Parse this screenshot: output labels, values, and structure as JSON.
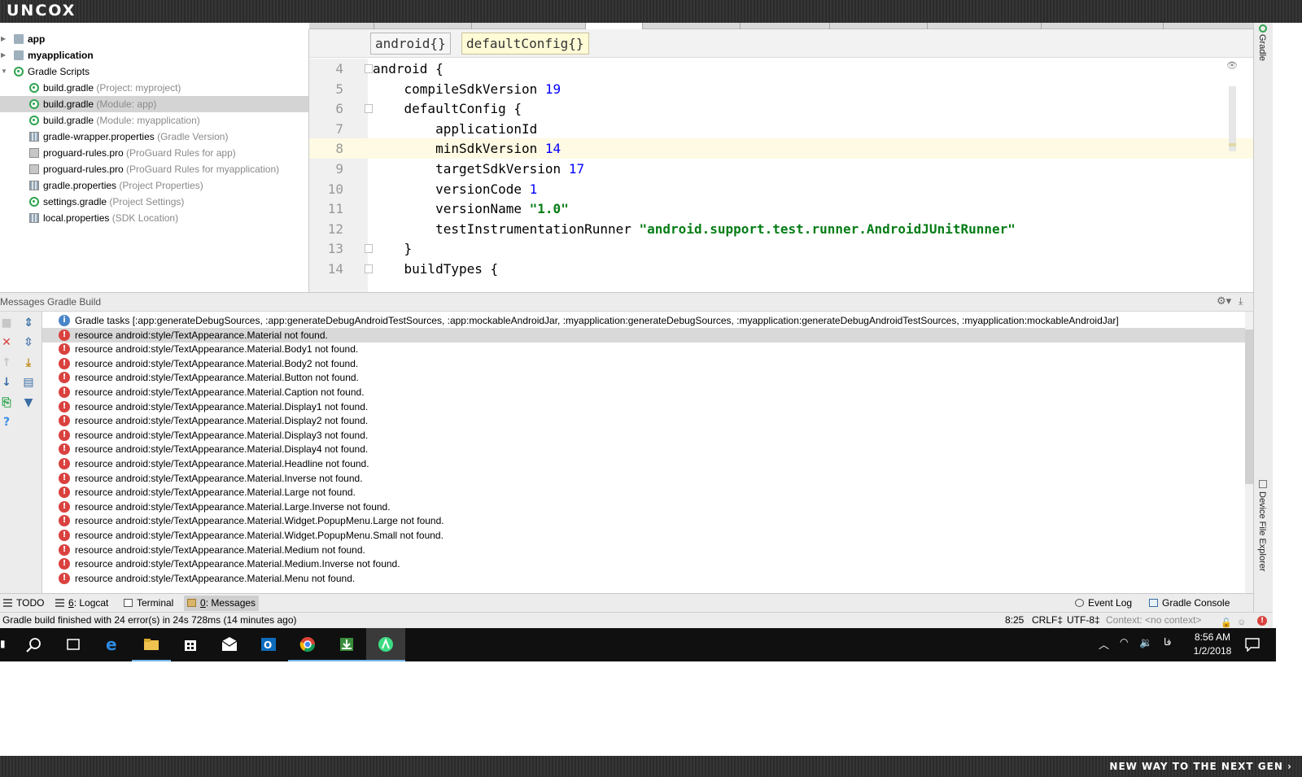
{
  "brand": "UNCOX",
  "project_tree": [
    {
      "label": "app",
      "hint": "",
      "icon": "folder-icon",
      "level": 0,
      "bold": true
    },
    {
      "label": "myapplication",
      "hint": "",
      "icon": "folder-icon",
      "level": 0,
      "bold": true
    },
    {
      "label": "Gradle Scripts",
      "hint": "",
      "icon": "gradle-icon",
      "level": 0,
      "bold": false
    },
    {
      "label": "build.gradle",
      "hint": "(Project: myproject)",
      "icon": "gradle-icon",
      "level": 1
    },
    {
      "label": "build.gradle",
      "hint": "(Module: app)",
      "icon": "gradle-icon",
      "level": 1,
      "selected": true
    },
    {
      "label": "build.gradle",
      "hint": "(Module: myapplication)",
      "icon": "gradle-icon",
      "level": 1
    },
    {
      "label": "gradle-wrapper.properties",
      "hint": "(Gradle Version)",
      "icon": "properties-icon",
      "level": 1
    },
    {
      "label": "proguard-rules.pro",
      "hint": "(ProGuard Rules for app)",
      "icon": "file-icon",
      "level": 1
    },
    {
      "label": "proguard-rules.pro",
      "hint": "(ProGuard Rules for myapplication)",
      "icon": "file-icon",
      "level": 1
    },
    {
      "label": "gradle.properties",
      "hint": "(Project Properties)",
      "icon": "properties-icon",
      "level": 1
    },
    {
      "label": "settings.gradle",
      "hint": "(Project Settings)",
      "icon": "gradle-icon",
      "level": 1
    },
    {
      "label": "local.properties",
      "hint": "(SDK Location)",
      "icon": "properties-icon",
      "level": 1
    }
  ],
  "editor": {
    "breadcrumbs": [
      "android{}",
      "defaultConfig{}"
    ],
    "current_line": "8",
    "lines": [
      {
        "n": "4",
        "fold": true,
        "parts": [
          {
            "t": "android {",
            "c": "plain"
          }
        ]
      },
      {
        "n": "5",
        "fold": false,
        "parts": [
          {
            "t": "    compileSdkVersion ",
            "c": "plain"
          },
          {
            "t": "19",
            "c": "num"
          }
        ]
      },
      {
        "n": "6",
        "fold": true,
        "parts": [
          {
            "t": "    defaultConfig {",
            "c": "plain"
          }
        ]
      },
      {
        "n": "7",
        "fold": false,
        "parts": [
          {
            "t": "        applicationId",
            "c": "plain"
          }
        ]
      },
      {
        "n": "8",
        "fold": false,
        "parts": [
          {
            "t": "        minSdkVersion ",
            "c": "plain"
          },
          {
            "t": "14",
            "c": "num"
          }
        ]
      },
      {
        "n": "9",
        "fold": false,
        "parts": [
          {
            "t": "        targetSdkVersion ",
            "c": "plain"
          },
          {
            "t": "17",
            "c": "num"
          }
        ]
      },
      {
        "n": "10",
        "fold": false,
        "parts": [
          {
            "t": "        versionCode ",
            "c": "plain"
          },
          {
            "t": "1",
            "c": "num"
          }
        ]
      },
      {
        "n": "11",
        "fold": false,
        "parts": [
          {
            "t": "        versionName ",
            "c": "plain"
          },
          {
            "t": "\"1.0\"",
            "c": "str"
          }
        ]
      },
      {
        "n": "12",
        "fold": false,
        "parts": [
          {
            "t": "        testInstrumentationRunner ",
            "c": "plain"
          },
          {
            "t": "\"android.support.test.runner.AndroidJUnitRunner\"",
            "c": "str"
          }
        ]
      },
      {
        "n": "13",
        "fold": true,
        "parts": [
          {
            "t": "    }",
            "c": "plain"
          }
        ]
      },
      {
        "n": "14",
        "fold": true,
        "parts": [
          {
            "t": "    buildTypes {",
            "c": "plain"
          }
        ]
      }
    ]
  },
  "right_stripe": {
    "gradle_tab": "Gradle",
    "device_tab": "Device File Explorer"
  },
  "messages": {
    "title": "Messages Gradle Build",
    "items": [
      {
        "type": "info",
        "text": "Gradle tasks [:app:generateDebugSources, :app:generateDebugAndroidTestSources, :app:mockableAndroidJar, :myapplication:generateDebugSources, :myapplication:generateDebugAndroidTestSources, :myapplication:mockableAndroidJar]"
      },
      {
        "type": "error",
        "text": "resource android:style/TextAppearance.Material not found.",
        "selected": true
      },
      {
        "type": "error",
        "text": "resource android:style/TextAppearance.Material.Body1 not found."
      },
      {
        "type": "error",
        "text": "resource android:style/TextAppearance.Material.Body2 not found."
      },
      {
        "type": "error",
        "text": "resource android:style/TextAppearance.Material.Button not found."
      },
      {
        "type": "error",
        "text": "resource android:style/TextAppearance.Material.Caption not found."
      },
      {
        "type": "error",
        "text": "resource android:style/TextAppearance.Material.Display1 not found."
      },
      {
        "type": "error",
        "text": "resource android:style/TextAppearance.Material.Display2 not found."
      },
      {
        "type": "error",
        "text": "resource android:style/TextAppearance.Material.Display3 not found."
      },
      {
        "type": "error",
        "text": "resource android:style/TextAppearance.Material.Display4 not found."
      },
      {
        "type": "error",
        "text": "resource android:style/TextAppearance.Material.Headline not found."
      },
      {
        "type": "error",
        "text": "resource android:style/TextAppearance.Material.Inverse not found."
      },
      {
        "type": "error",
        "text": "resource android:style/TextAppearance.Material.Large not found."
      },
      {
        "type": "error",
        "text": "resource android:style/TextAppearance.Material.Large.Inverse not found."
      },
      {
        "type": "error",
        "text": "resource android:style/TextAppearance.Material.Widget.PopupMenu.Large not found."
      },
      {
        "type": "error",
        "text": "resource android:style/TextAppearance.Material.Widget.PopupMenu.Small not found."
      },
      {
        "type": "error",
        "text": "resource android:style/TextAppearance.Material.Medium not found."
      },
      {
        "type": "error",
        "text": "resource android:style/TextAppearance.Material.Medium.Inverse not found."
      },
      {
        "type": "error",
        "text": "resource android:style/TextAppearance.Material.Menu not found."
      }
    ]
  },
  "tool_tabs": {
    "todo": "TODO",
    "logcat_num": "6",
    "logcat": ": Logcat",
    "terminal": "Terminal",
    "messages_num": "0",
    "messages": ": Messages",
    "event_log": "Event Log",
    "gradle_console": "Gradle Console"
  },
  "status": {
    "message": "Gradle build finished with 24 error(s) in 24s 728ms (14 minutes ago)",
    "position": "8:25",
    "line_sep": "CRLF‡",
    "encoding": "UTF-8‡",
    "context": "Context: <no context>"
  },
  "taskbar": {
    "apps": [
      "task-view-icon",
      "edge-icon",
      "file-explorer-icon",
      "store-icon",
      "mail-icon",
      "outlook-icon",
      "chrome-icon",
      "downloader-icon",
      "android-studio-icon"
    ],
    "lang": "فا",
    "time": "8:56 AM",
    "date": "1/2/2018"
  },
  "footer": "NEW WAY TO THE NEXT GEN ›",
  "colors": {
    "error": "#d9423f",
    "info": "#4a86c8",
    "number": "#0000ff",
    "string": "#067d17",
    "current_line": "#fffae3"
  }
}
